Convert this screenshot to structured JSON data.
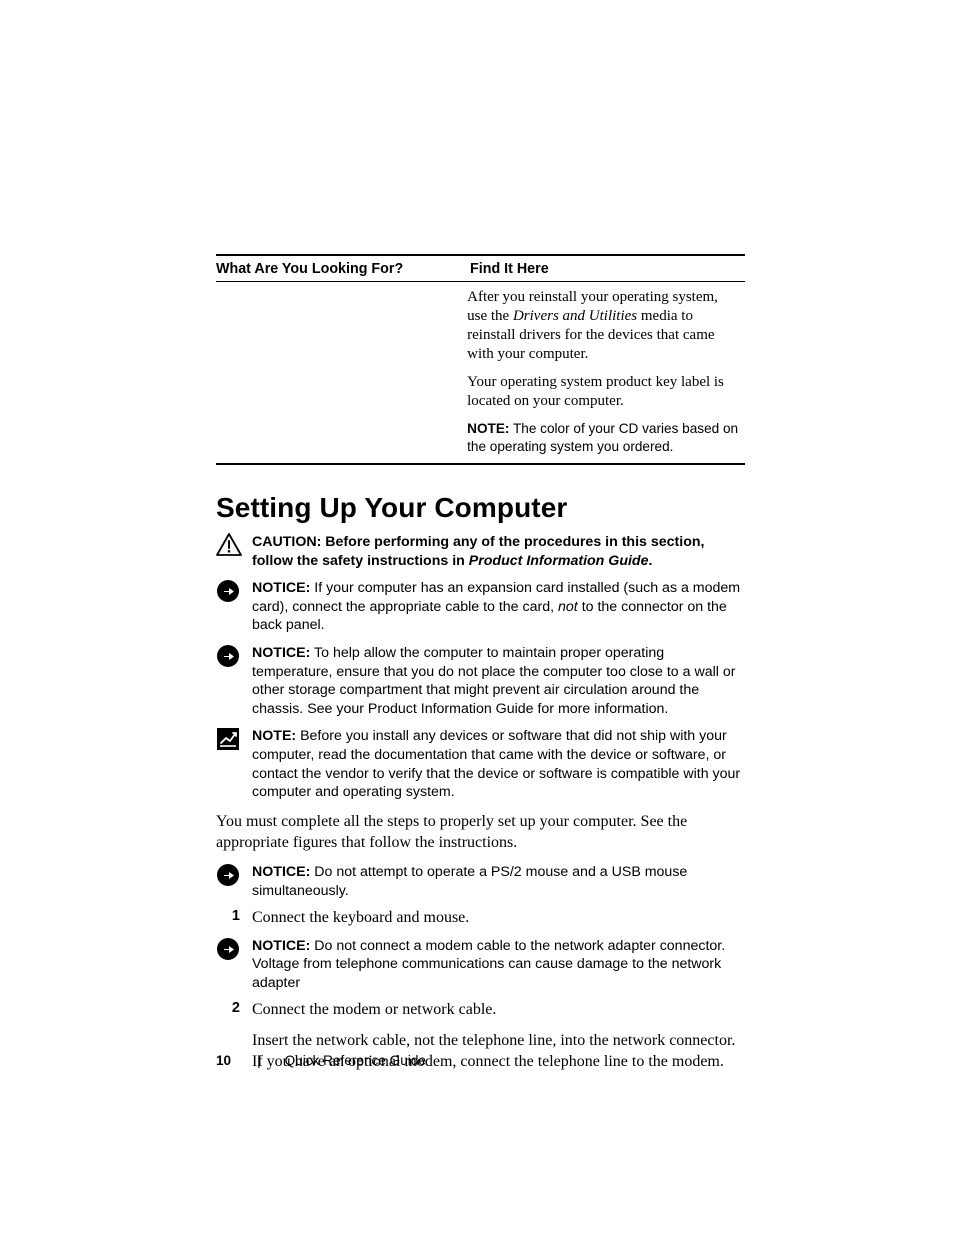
{
  "table": {
    "header_left": "What Are You Looking For?",
    "header_right": "Find It Here",
    "para1_a": "After you reinstall your operating system, use the ",
    "para1_it": "Drivers and Utilities",
    "para1_b": " media to reinstall drivers for the devices that came with your computer.",
    "para2": "Your operating system product key label is located on your computer.",
    "note_label": "NOTE:",
    "note_text": " The color of your CD varies based on the operating system you ordered."
  },
  "heading": "Setting Up Your Computer",
  "caution": {
    "label": "CAUTION: ",
    "text_a": "Before performing any of the procedures in this section, follow the safety instructions in ",
    "text_bi": "Product Information Guide",
    "text_b": "."
  },
  "notice1": {
    "label": "NOTICE:",
    "a": " If your computer has an expansion card installed (such as a modem card), connect the appropriate cable to the card, ",
    "it": "not ",
    "b": "to the connector on the back panel."
  },
  "notice2": {
    "label": "NOTICE:",
    "a": " To help allow the computer to maintain proper operating temperature, ensure that you do not place the computer too close to a wall or other storage compartment that might prevent air circulation around the chassis. See your Product Information Guide for more information."
  },
  "note_block": {
    "label": "NOTE:",
    "a": " Before you install any devices or software that did not ship with your computer, read the documentation that came with the device or software, or contact the vendor to verify that the device or software is compatible with your computer and operating system."
  },
  "body1": "You must complete all the steps to properly set up your computer. See the appropriate figures that follow the instructions.",
  "notice3": {
    "label": "NOTICE:",
    "a": " Do not attempt to operate a PS/2 mouse and a USB mouse simultaneously."
  },
  "step1": {
    "n": "1",
    "t": "Connect the keyboard and mouse."
  },
  "notice4": {
    "label": "NOTICE:",
    "a": " Do not connect a modem cable to the network adapter connector. Voltage from telephone communications can cause damage to the network adapter"
  },
  "step2": {
    "n": "2",
    "t": "Connect the modem or network cable.",
    "sub": "Insert the network cable, not the telephone line, into the network connector. If you have an optional modem, connect the telephone line to the modem."
  },
  "footer": {
    "page": "10",
    "title": "Quick Reference Guide"
  }
}
